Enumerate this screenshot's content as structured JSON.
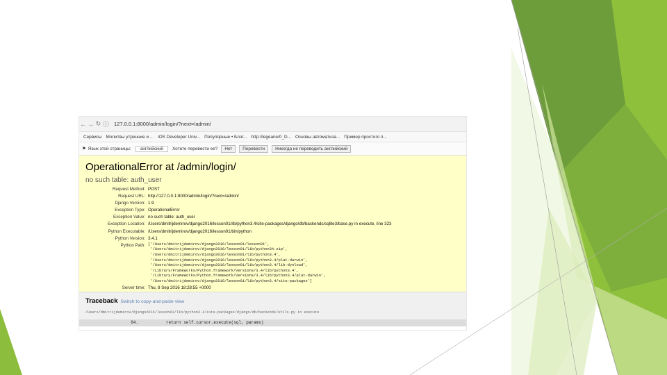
{
  "browser": {
    "url": "127.0.0.1:8000/admin/login/?next=/admin/",
    "bookmarks": [
      "Сервисы",
      "Молитвы утренние и ...",
      "iOS Developer Univ...",
      "Популярные • Блог...",
      "http://legeane/0_D...",
      "Основы автоматиза...",
      "Пример простого п..."
    ],
    "translate_bar": {
      "language_prompt": "Язык этой страницы:",
      "language": "английский",
      "question": "Хотите перевести ее?",
      "no_label": "Нет",
      "translate_label": "Перевести",
      "never_label": "Никогда не переводить английский"
    }
  },
  "error": {
    "title": "OperationalError at /admin/login/",
    "subtitle": "no such table: auth_user",
    "meta": [
      {
        "key": "Request Method:",
        "value": "POST"
      },
      {
        "key": "Request URL:",
        "value": "http://127.0.0.1:8000/admin/login/?next=/admin/"
      },
      {
        "key": "Django Version:",
        "value": "1.9"
      },
      {
        "key": "Exception Type:",
        "value": "OperationalError"
      },
      {
        "key": "Exception Value:",
        "value": "no such table: auth_user"
      },
      {
        "key": "Exception Location:",
        "value": "/Users/dmitrijdemirov/django2016/lesson01/lib/python3.4/site-packages/django/db/backends/sqlite3/base.py in execute, line 323"
      },
      {
        "key": "Python Executable:",
        "value": "/Users/dmitrijdemirov/django2016/lesson01/bin/python"
      },
      {
        "key": "Python Version:",
        "value": "3.4.1"
      }
    ],
    "python_path_label": "Python Path:",
    "python_path": "['/Users/dmitrijdemirov/django2016/lesson01/lesson01',\n '/Users/dmitrijdemirov/django2016/lesson01/lib/python34.zip',\n '/Users/dmitrijdemirov/django2016/lesson01/lib/python3.4',\n '/Users/dmitrijdemirov/django2016/lesson01/lib/python3.4/plat-darwin',\n '/Users/dmitrijdemirov/django2016/lesson01/lib/python3.4/lib-dynload',\n '/Library/Frameworks/Python.framework/Versions/3.4/lib/python3.4',\n '/Library/Frameworks/Python.framework/Versions/3.4/lib/python3.4/plat-darwin',\n '/Users/dmitrijdemirov/django2016/lesson01/lib/python3.4/site-packages']",
    "server_time_label": "Server time:",
    "server_time": "Thu, 8 Sep 2016 18:28:55 +0000"
  },
  "traceback": {
    "heading": "Traceback",
    "switch_link": "Switch to copy-and-paste view",
    "file": "/Users/dmitrijdemirov/django2016/lesson01/lib/python3.4/site-packages/django/db/backends/utils.py in execute",
    "line_no": "64.",
    "code": "return self.cursor.execute(sql, params)"
  },
  "colors": {
    "slide_green_dark": "#6c9a3a",
    "slide_green_mid": "#8dbd3c",
    "slide_green_light": "#a8d05a",
    "error_bg": "#ffffc8",
    "traceback_bg": "#f0f0f0",
    "link": "#5b80b2"
  }
}
